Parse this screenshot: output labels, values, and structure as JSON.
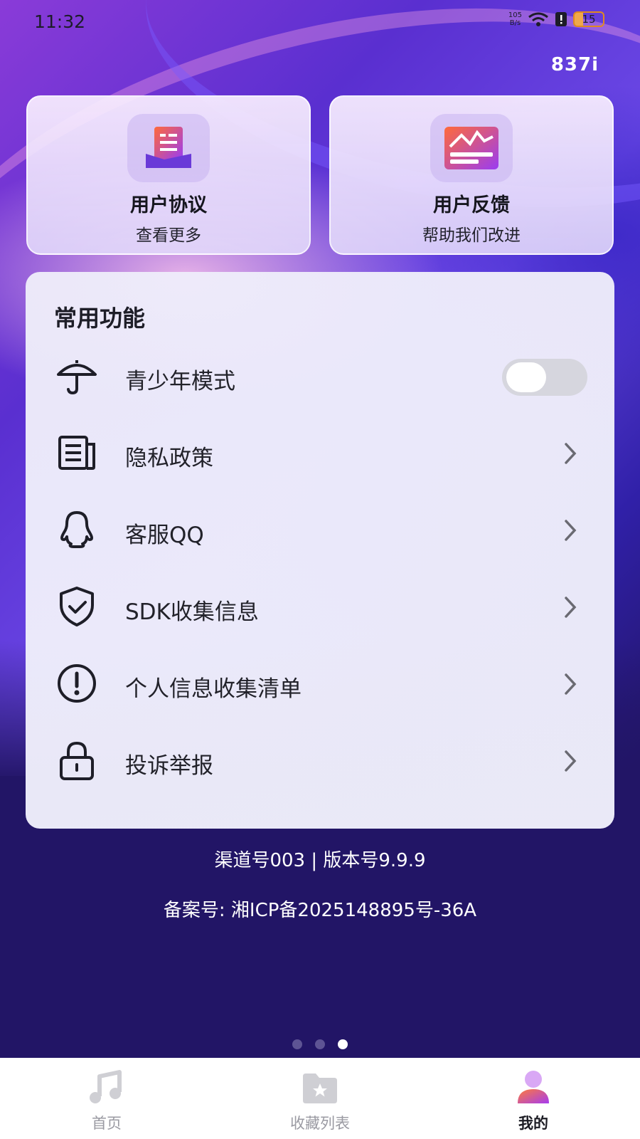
{
  "status_bar": {
    "time": "11:32",
    "net_speed_value": "105",
    "net_speed_unit": "B/s",
    "battery": "15"
  },
  "top_right_text": "837i",
  "cards": [
    {
      "title": "用户协议",
      "subtitle": "查看更多",
      "icon": "document-icon"
    },
    {
      "title": "用户反馈",
      "subtitle": "帮助我们改进",
      "icon": "feedback-chart-icon"
    }
  ],
  "panel": {
    "title": "常用功能",
    "items": [
      {
        "label": "青少年模式",
        "icon": "umbrella-icon",
        "control": "toggle",
        "toggle_on": false
      },
      {
        "label": "隐私政策",
        "icon": "newspaper-icon",
        "control": "chevron"
      },
      {
        "label": "客服QQ",
        "icon": "qq-icon",
        "control": "chevron"
      },
      {
        "label": "SDK收集信息",
        "icon": "shield-check-icon",
        "control": "chevron"
      },
      {
        "label": "个人信息收集清单",
        "icon": "exclamation-circle-icon",
        "control": "chevron"
      },
      {
        "label": "投诉举报",
        "icon": "lock-icon",
        "control": "chevron"
      }
    ]
  },
  "footer": {
    "line1": "渠道号003 | 版本号9.9.9",
    "line2": "备案号: 湘ICP备2025148895号-36A"
  },
  "page_indicator": {
    "count": 3,
    "active_index": 2
  },
  "tabbar": {
    "tabs": [
      {
        "label": "首页",
        "icon": "music-note-icon",
        "active": false
      },
      {
        "label": "收藏列表",
        "icon": "folder-star-icon",
        "active": false
      },
      {
        "label": "我的",
        "icon": "user-icon",
        "active": true
      }
    ]
  },
  "colors": {
    "accent_gradient_start": "#ff7a3a",
    "accent_gradient_end": "#a63cf0",
    "footer_bg": "#221566"
  }
}
